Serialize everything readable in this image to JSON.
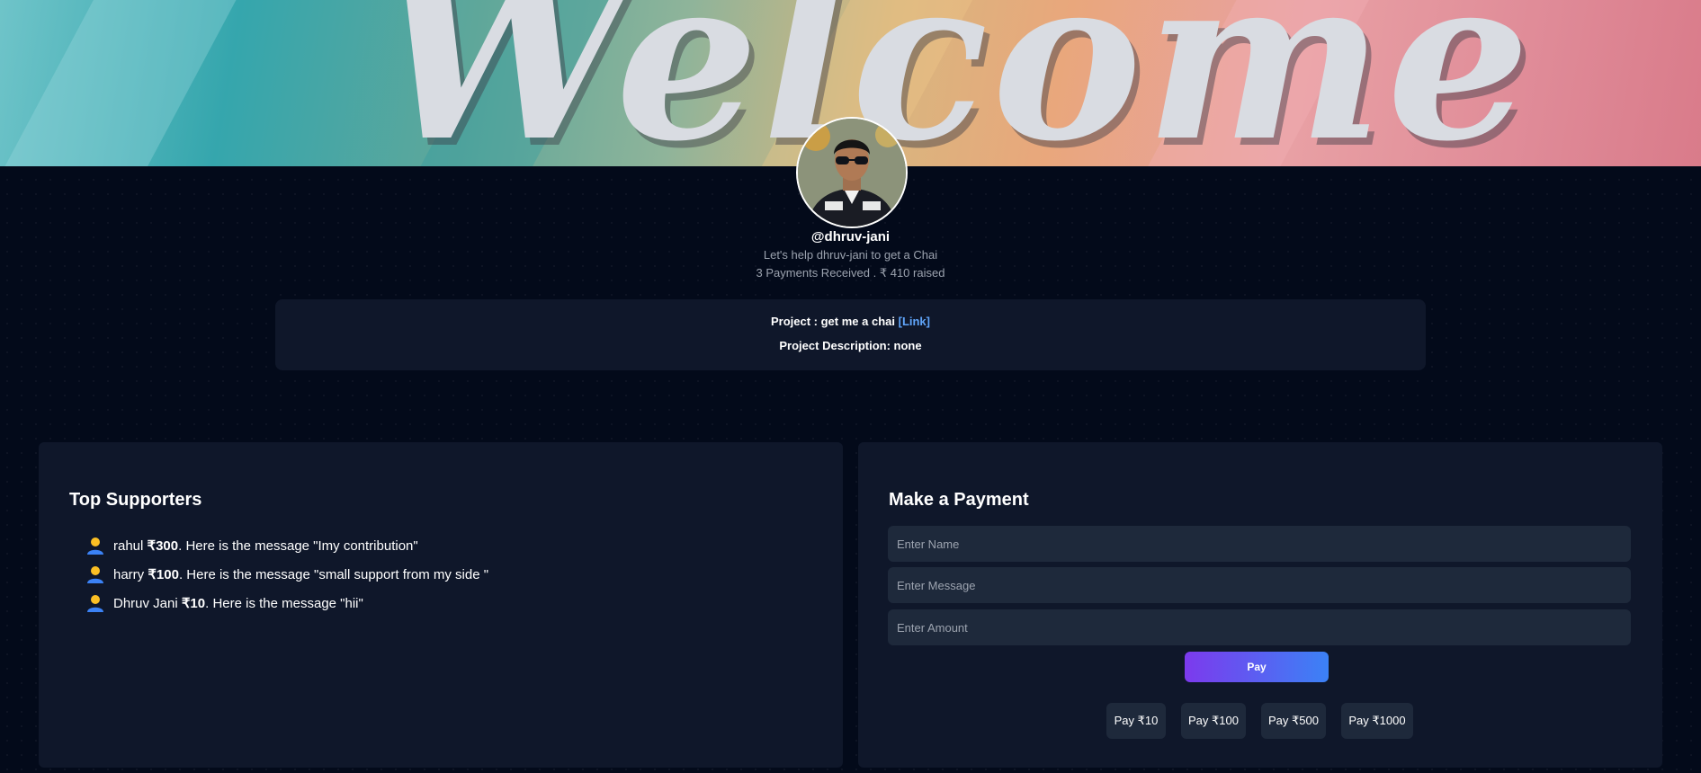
{
  "banner": {
    "text": "Welcome"
  },
  "profile": {
    "username": "@dhruv-jani",
    "tagline": "Let's help dhruv-jani to get a Chai",
    "stats": "3 Payments Received . ₹ 410 raised"
  },
  "project": {
    "title_prefix": "Project : get me a chai",
    "link_label": "[Link]",
    "description": "Project Description: none"
  },
  "supporters": {
    "heading": "Top Supporters",
    "items": [
      {
        "name": "rahul",
        "amount": "₹300",
        "message": ". Here is the message \"Imy contribution\""
      },
      {
        "name": "harry",
        "amount": "₹100",
        "message": ". Here is the message \"small support from my side \""
      },
      {
        "name": "Dhruv Jani",
        "amount": "₹10",
        "message": ". Here is the message \"hii\""
      }
    ]
  },
  "payment": {
    "heading": "Make a Payment",
    "name_placeholder": "Enter Name",
    "message_placeholder": "Enter Message",
    "amount_placeholder": "Enter Amount",
    "pay_label": "Pay",
    "quick_pay": [
      "Pay ₹10",
      "Pay ₹100",
      "Pay ₹500",
      "Pay ₹1000"
    ]
  },
  "colors": {
    "background": "#030a1a",
    "panel": "#0f172a",
    "input": "#1e293b",
    "link": "#60a5fa",
    "pay_gradient_start": "#7c3aed",
    "pay_gradient_end": "#3b82f6"
  },
  "icons": {
    "supporter": "user-icon"
  }
}
